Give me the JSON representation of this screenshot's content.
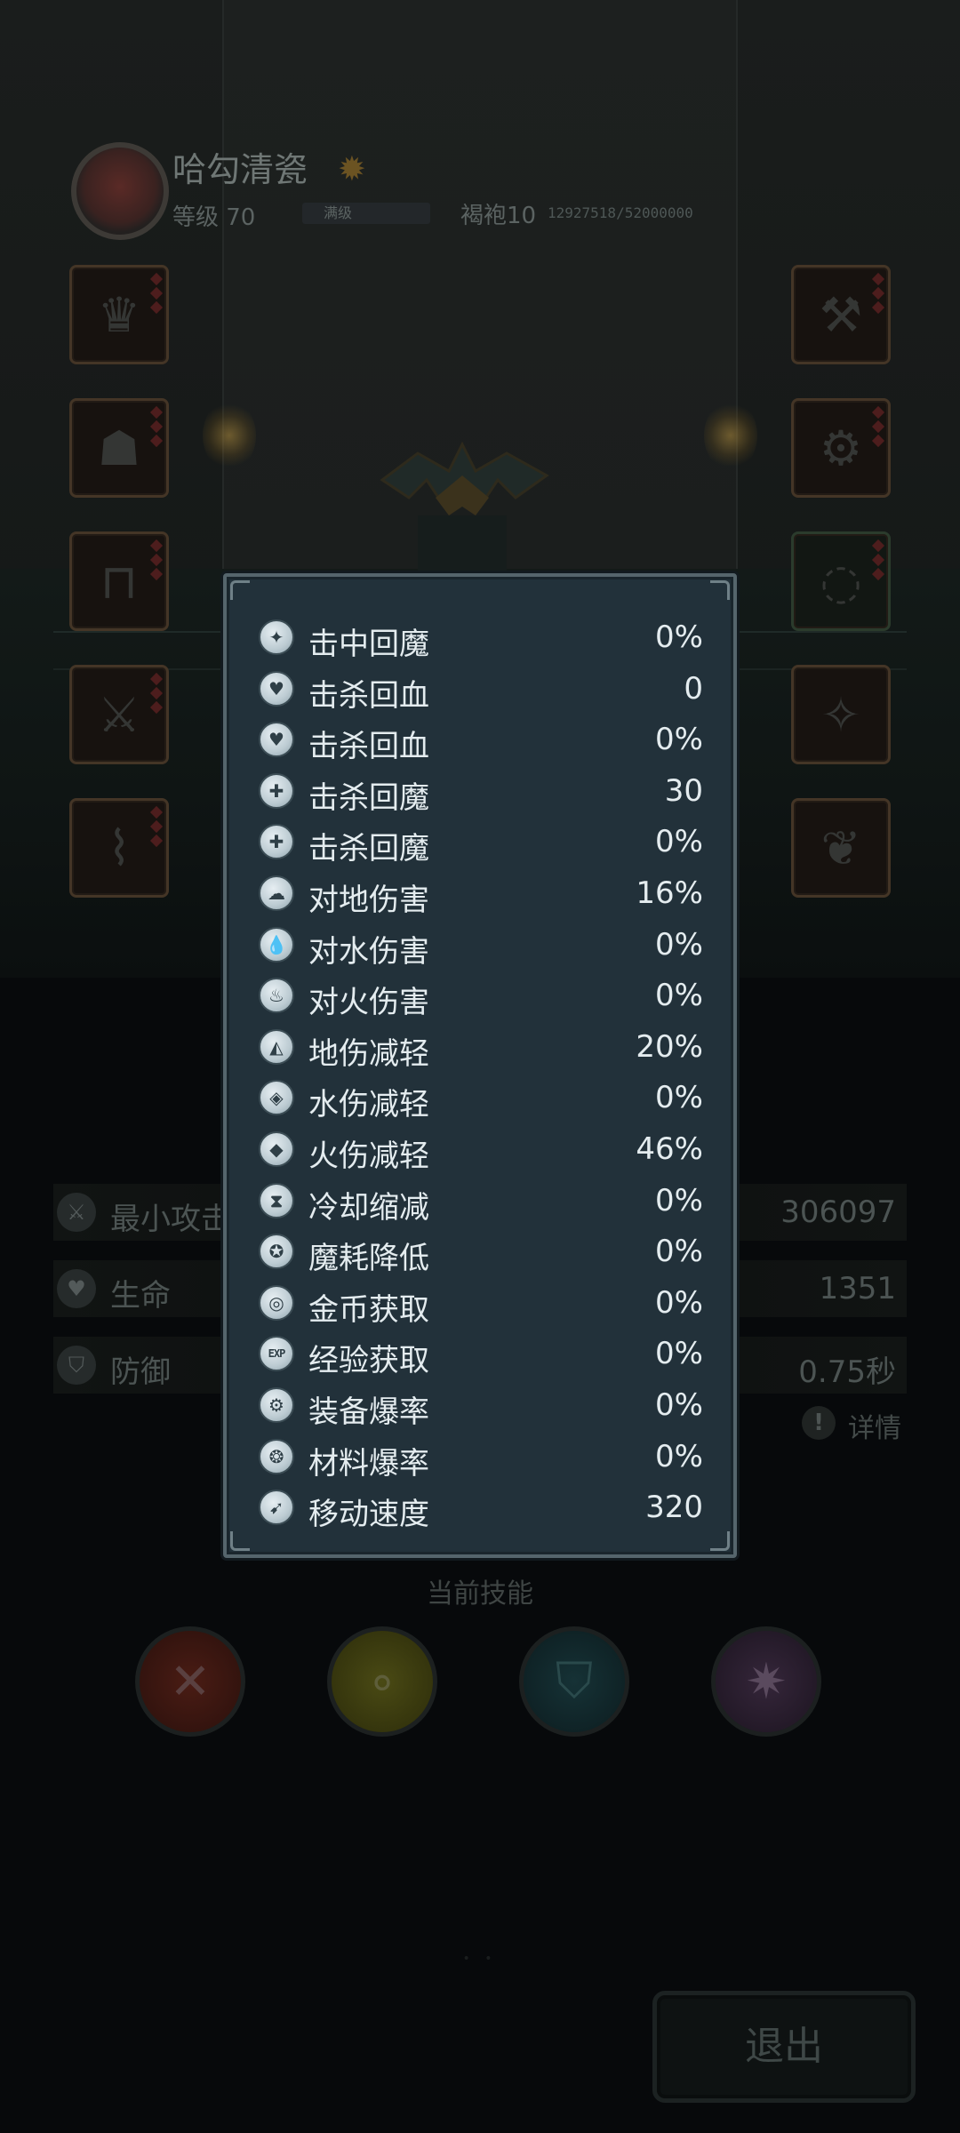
{
  "player": {
    "name": "哈勾清瓷",
    "level_text": "等级 70",
    "level_bar_label": "满级",
    "level_progress": 1.0,
    "rank": "褐袍10",
    "exp_text": "12927518/52000000"
  },
  "equipment": {
    "left": [
      {
        "icon": "helmet-icon",
        "gems": 3
      },
      {
        "icon": "armor-icon",
        "gems": 3
      },
      {
        "icon": "pants-icon",
        "gems": 3
      },
      {
        "icon": "weapon-icon",
        "gems": 3
      },
      {
        "icon": "boots-icon",
        "gems": 3
      }
    ],
    "right": [
      {
        "icon": "axe-icon",
        "gems": 3
      },
      {
        "icon": "ring-icon",
        "gems": 3
      },
      {
        "icon": "necklace-icon",
        "gems": 3
      },
      {
        "icon": "charm-icon",
        "gems": 0
      },
      {
        "icon": "heart-relic-icon",
        "gems": 0
      }
    ]
  },
  "base_stats": [
    {
      "icon": "sword-icon",
      "label": "最小攻击",
      "value": "306097"
    },
    {
      "icon": "heart-icon",
      "label": "生命",
      "value": "1351"
    },
    {
      "icon": "shield-icon",
      "label": "防御",
      "value": "0.75秒"
    }
  ],
  "details_label": "详情",
  "skills_title": "当前技能",
  "skills": [
    {
      "icon": "crossed-axes-icon",
      "color": "#3a1712"
    },
    {
      "icon": "bubbles-icon",
      "color": "#35360f"
    },
    {
      "icon": "water-shield-icon",
      "color": "#102428"
    },
    {
      "icon": "burst-icon",
      "color": "#241a28"
    }
  ],
  "exit_label": "退出",
  "popup": {
    "attributes": [
      {
        "icon": "mana-hit-icon",
        "label": "击中回魔",
        "value": "0%"
      },
      {
        "icon": "heart-plus-icon",
        "label": "击杀回血",
        "value": "0"
      },
      {
        "icon": "heart-percent-icon",
        "label": "击杀回血",
        "value": "0%"
      },
      {
        "icon": "mana-plus-icon",
        "label": "击杀回魔",
        "value": "30"
      },
      {
        "icon": "mana-percent-icon",
        "label": "击杀回魔",
        "value": "0%"
      },
      {
        "icon": "earth-icon",
        "label": "对地伤害",
        "value": "16%"
      },
      {
        "icon": "water-drop-icon",
        "label": "对水伤害",
        "value": "0%"
      },
      {
        "icon": "flame-icon",
        "label": "对火伤害",
        "value": "0%"
      },
      {
        "icon": "earth-shield-icon",
        "label": "地伤减轻",
        "value": "20%"
      },
      {
        "icon": "water-shield-icon",
        "label": "水伤减轻",
        "value": "0%"
      },
      {
        "icon": "fire-shield-icon",
        "label": "火伤减轻",
        "value": "46%"
      },
      {
        "icon": "hourglass-icon",
        "label": "冷却缩减",
        "value": "0%"
      },
      {
        "icon": "mana-down-icon",
        "label": "魔耗降低",
        "value": "0%"
      },
      {
        "icon": "coin-icon",
        "label": "金币获取",
        "value": "0%"
      },
      {
        "icon": "exp-icon",
        "label": "经验获取",
        "value": "0%"
      },
      {
        "icon": "gear-drop-icon",
        "label": "装备爆率",
        "value": "0%"
      },
      {
        "icon": "material-drop-icon",
        "label": "材料爆率",
        "value": "0%"
      },
      {
        "icon": "boot-speed-icon",
        "label": "移动速度",
        "value": "320"
      }
    ]
  }
}
